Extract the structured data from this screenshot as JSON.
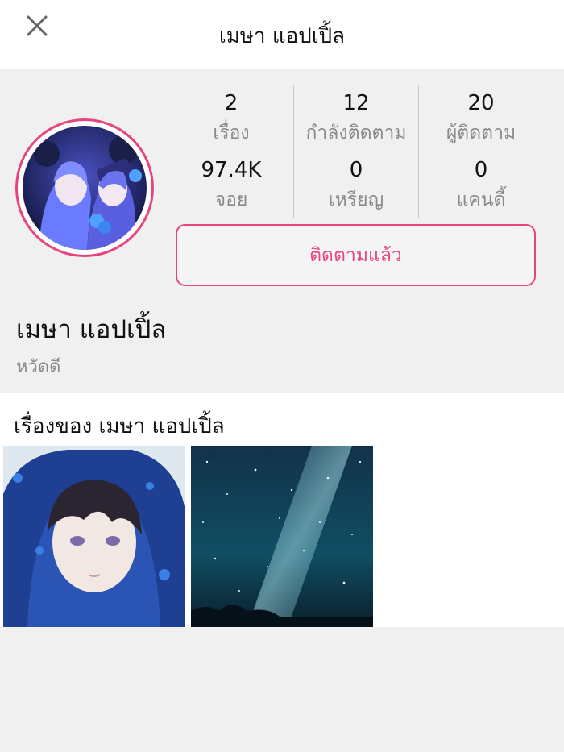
{
  "header": {
    "title": "เมษา แอปเปิ้ล",
    "close_icon": "close-icon"
  },
  "profile": {
    "name": "เมษา แอปเปิ้ล",
    "bio": "หวัดดี",
    "follow_button": "ติดตามแล้ว",
    "accent_color": "#e8457f",
    "stats": [
      {
        "value": "2",
        "label": "เรื่อง"
      },
      {
        "value": "12",
        "label": "กำลังติดตาม"
      },
      {
        "value": "20",
        "label": "ผู้ติดตาม"
      },
      {
        "value": "97.4K",
        "label": "จอย"
      },
      {
        "value": "0",
        "label": "เหรียญ"
      },
      {
        "value": "0",
        "label": "แคนดี้"
      }
    ]
  },
  "stories": {
    "title": "เรื่องของ เมษา แอปเปิ้ล",
    "items": [
      {
        "thumbnail": "anime-boy-hood-image"
      },
      {
        "thumbnail": "starry-sky-image"
      }
    ]
  }
}
